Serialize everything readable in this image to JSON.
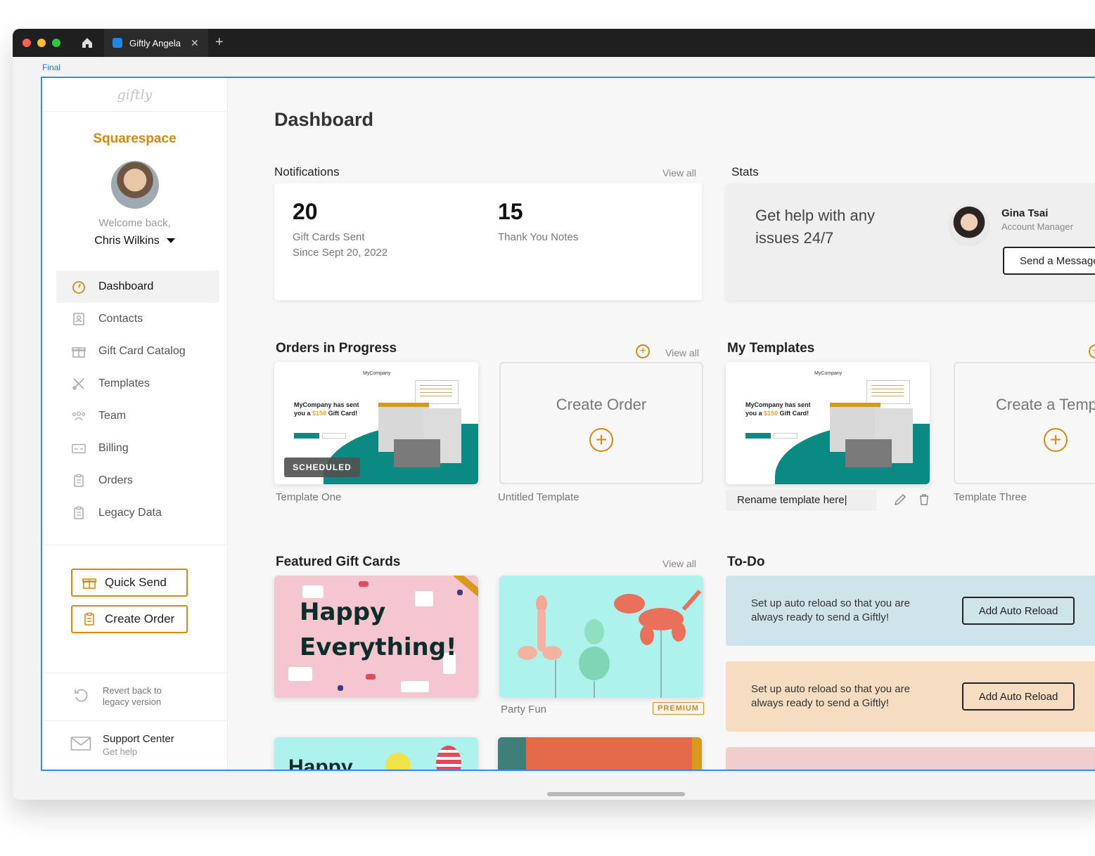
{
  "browser": {
    "tab_title": "Giftly Angela",
    "tab_close": "✕",
    "new_tab": "+"
  },
  "frame_label": "Final",
  "sidebar": {
    "logo": "giftly",
    "company": "Squarespace",
    "welcome": "Welcome back,",
    "user_name": "Chris Wilkins",
    "nav": [
      {
        "label": "Dashboard",
        "icon": "gauge-icon",
        "active": true
      },
      {
        "label": "Contacts",
        "icon": "contact-book-icon"
      },
      {
        "label": "Gift Card Catalog",
        "icon": "gift-icon"
      },
      {
        "label": "Templates",
        "icon": "tools-icon"
      },
      {
        "label": "Team",
        "icon": "team-icon"
      },
      {
        "label": "Billing",
        "icon": "credit-card-icon"
      },
      {
        "label": "Orders",
        "icon": "clipboard-icon"
      },
      {
        "label": "Legacy Data",
        "icon": "clipboard-icon"
      }
    ],
    "quick_send": "Quick Send",
    "create_order": "Create Order",
    "revert_line1": "Revert back to",
    "revert_line2": "legacy version",
    "support_title": "Support Center",
    "support_sub": "Get help"
  },
  "main": {
    "title": "Dashboard",
    "notifications": {
      "title": "Notifications",
      "view_all": "View all",
      "gift_cards_count": "20",
      "gift_cards_label": "Gift Cards Sent",
      "gift_cards_since": "Since Sept 20, 2022",
      "thank_you_count": "15",
      "thank_you_label": "Thank You Notes"
    },
    "stats": {
      "title": "Stats",
      "help_text": "Get help with any issues 24/7",
      "manager_name": "Gina Tsai",
      "manager_role": "Account Manager",
      "send_message": "Send a Message"
    },
    "orders": {
      "title": "Orders in Progress",
      "view_all": "View all",
      "template_one": "Template One",
      "scheduled": "SCHEDULED",
      "create_order": "Create Order",
      "untitled": "Untitled Template"
    },
    "templates": {
      "title": "My Templates",
      "rename_value": "Rename template here|",
      "create_template": "Create a Temp",
      "template_three": "Template Three"
    },
    "preview": {
      "company": "MyCompany",
      "headline_1": "MyCompany has sent",
      "headline_2": "you a",
      "amount": "$150",
      "headline_3": "Gift Card!"
    },
    "featured": {
      "title": "Featured Gift Cards",
      "view_all": "View all",
      "happy_1": "Happy",
      "happy_2": "Everything!",
      "party_fun": "Party Fun",
      "premium": "PREMIUM",
      "happy_3": "Happy"
    },
    "todo": {
      "title": "To-Do",
      "item_text": "Set up auto reload so that you are always ready to send a Giftly!",
      "item_button": "Add Auto Reload"
    }
  },
  "colors": {
    "accent": "#d78a0f",
    "teal": "#0a8a82",
    "todo_blue": "#cfe3ea",
    "todo_peach": "#f6dcc0",
    "todo_pink": "#f2cdcd",
    "frame_blue": "#2f8cf0"
  }
}
